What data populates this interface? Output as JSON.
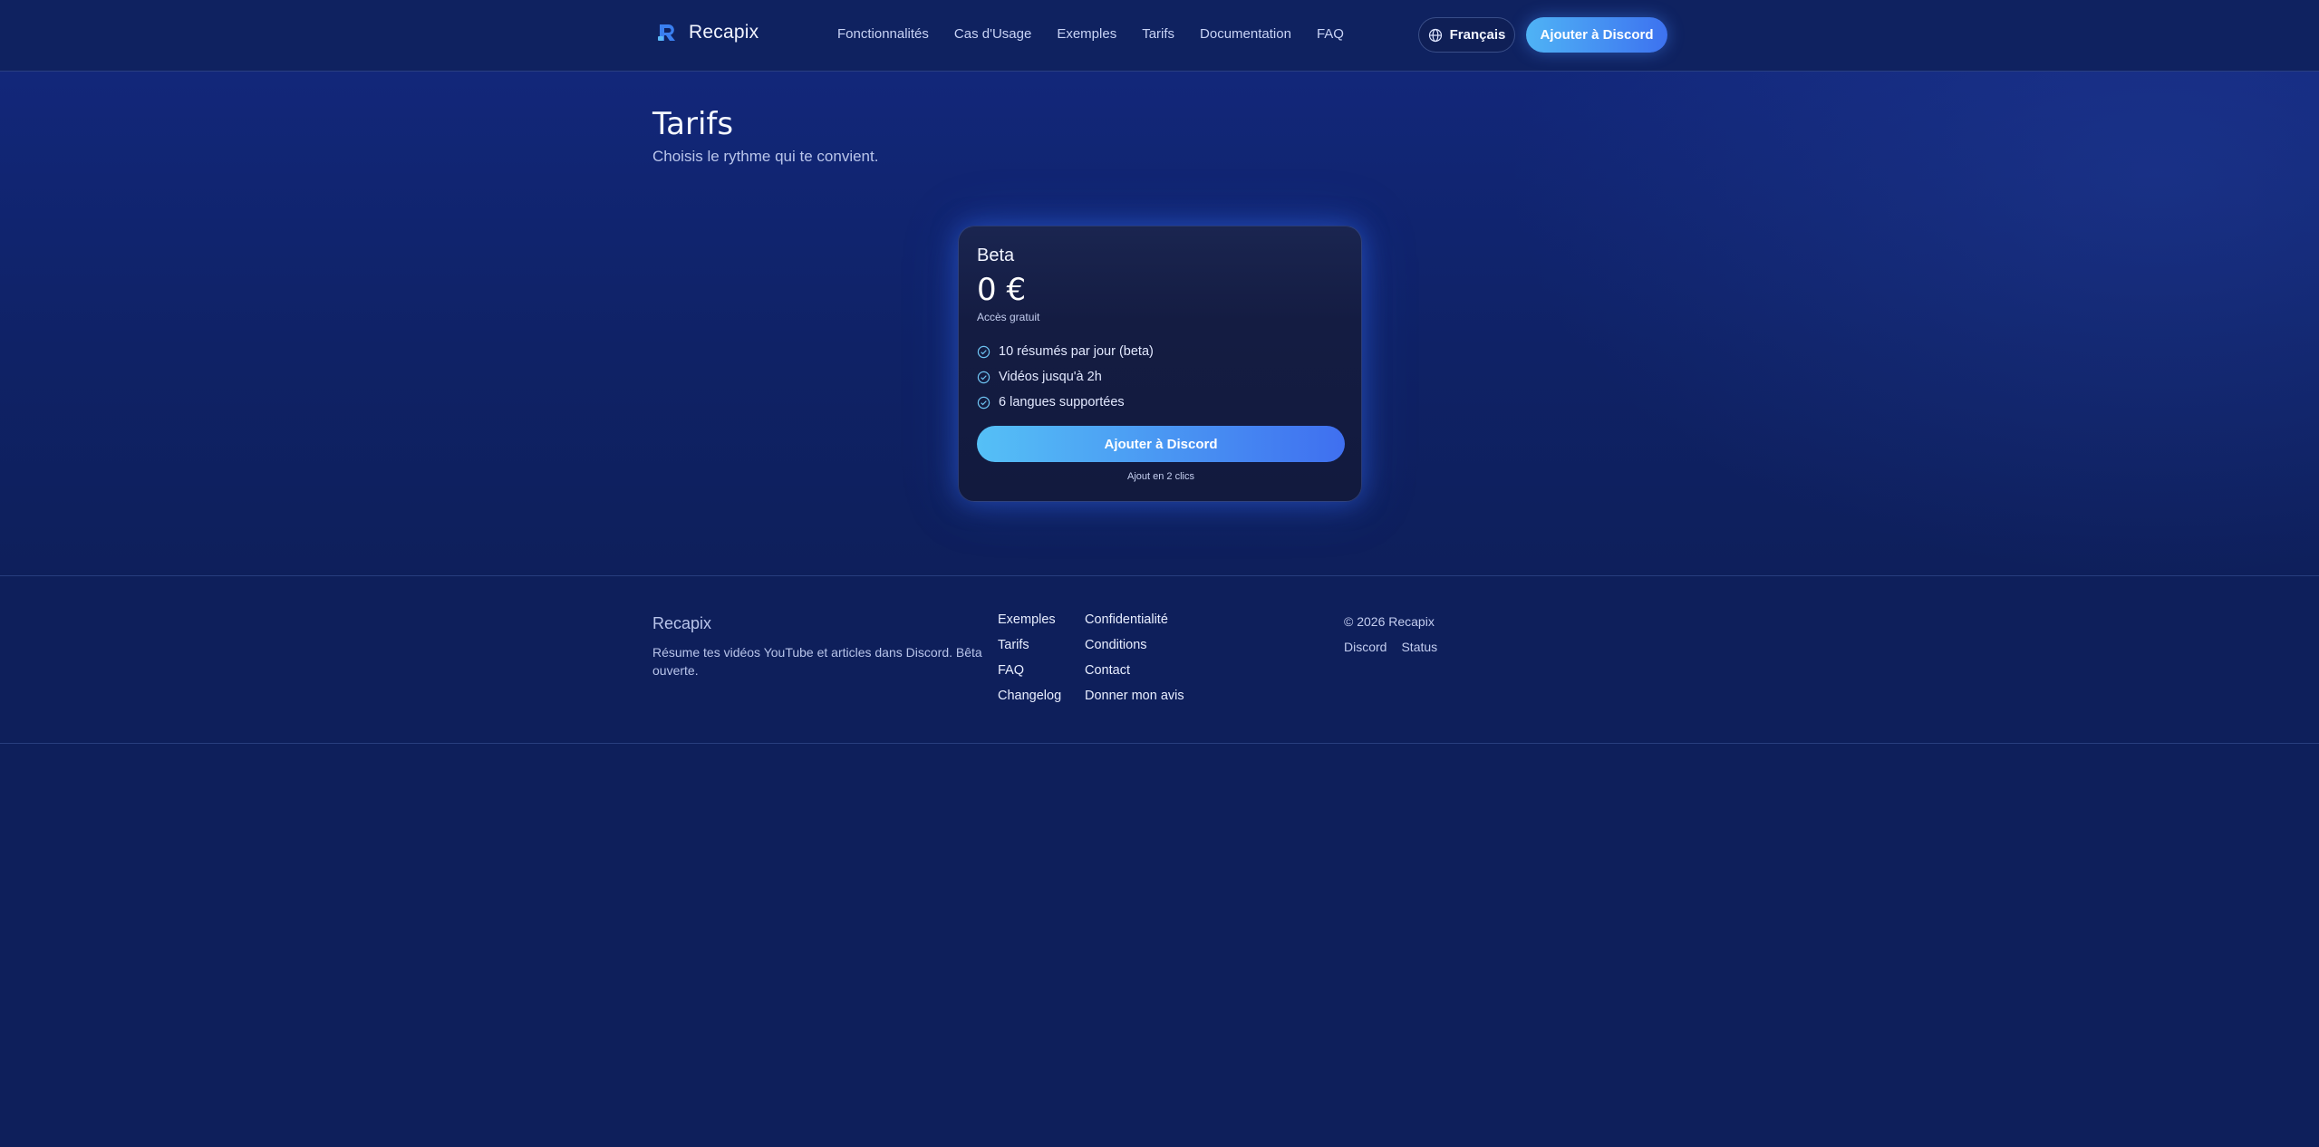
{
  "header": {
    "brand": "Recapix",
    "nav": [
      "Fonctionnalités",
      "Cas d'Usage",
      "Exemples",
      "Tarifs",
      "Documentation",
      "FAQ"
    ],
    "language": "Français",
    "cta": "Ajouter à Discord"
  },
  "hero": {
    "title": "Tarifs",
    "subtitle": "Choisis le rythme qui te convient."
  },
  "plan": {
    "name": "Beta",
    "price": "0 €",
    "note": "Accès gratuit",
    "features": [
      "10 résumés par jour (beta)",
      "Vidéos jusqu'à 2h",
      "6 langues supportées"
    ],
    "cta": "Ajouter à Discord",
    "footnote": "Ajout en 2 clics"
  },
  "footer": {
    "brand": "Recapix",
    "description": "Résume tes vidéos YouTube et articles dans Discord. Bêta ouverte.",
    "col1": [
      "Exemples",
      "Tarifs",
      "FAQ",
      "Changelog"
    ],
    "col2": [
      "Confidentialité",
      "Conditions",
      "Contact",
      "Donner mon avis"
    ],
    "copyright": "© 2026 Recapix",
    "social": [
      "Discord",
      "Status"
    ]
  },
  "colors": {
    "background": "#0e1f5b",
    "accent_start": "#4fb3f5",
    "accent_end": "#3d72f0",
    "card": "#141c42"
  },
  "icons": {
    "logo": "recapix-logo-icon",
    "language": "globe-icon",
    "feature": "check-circle-icon"
  }
}
